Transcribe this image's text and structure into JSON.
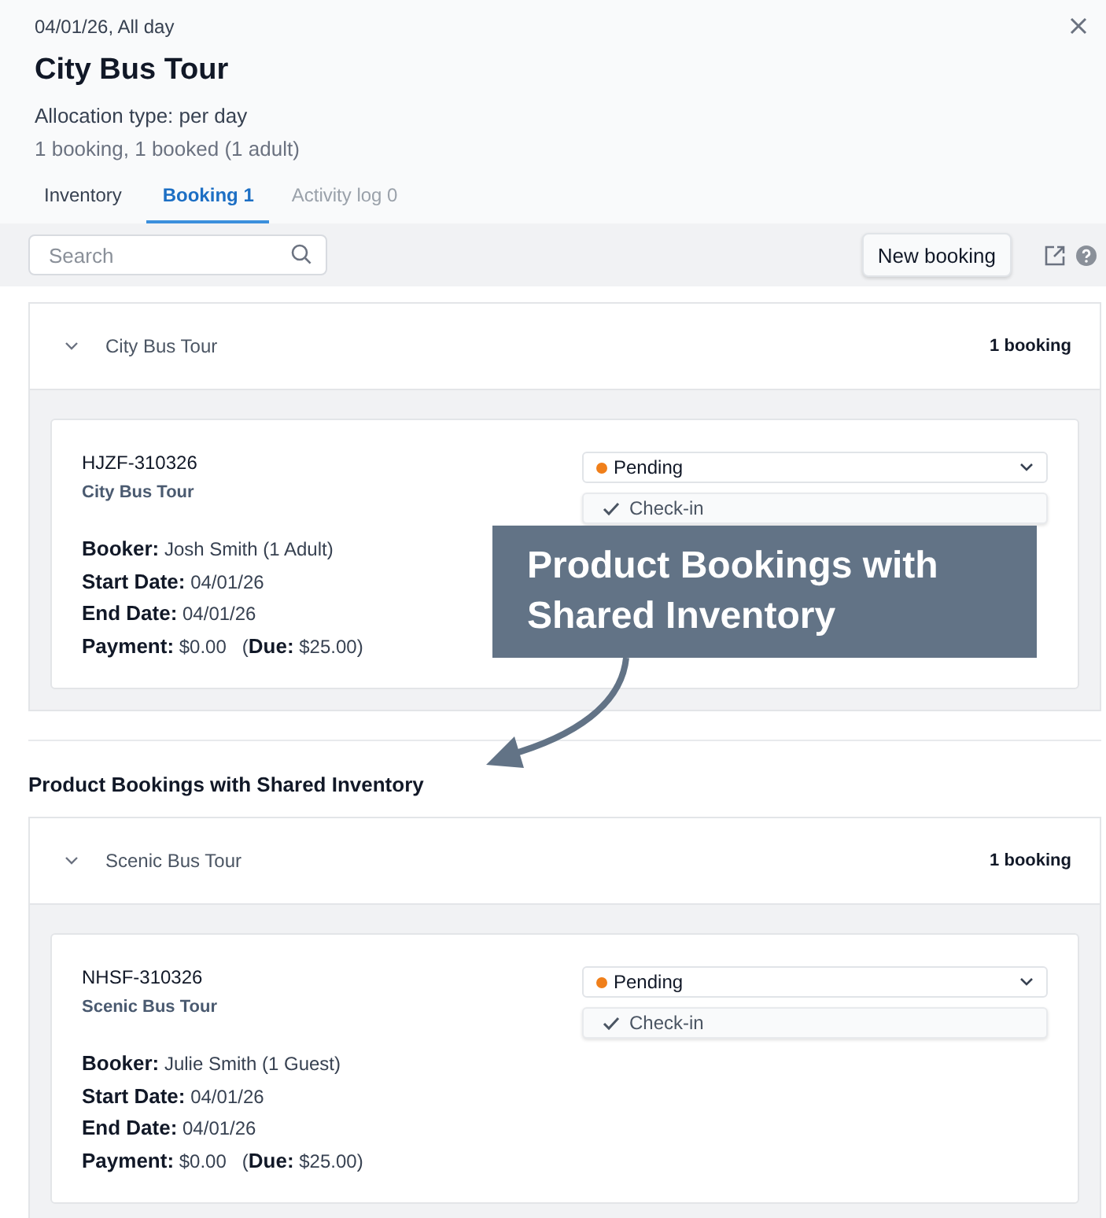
{
  "header": {
    "date": "04/01/26, All day",
    "title": "City Bus Tour",
    "allocation": "Allocation type: per day",
    "summary": "1 booking, 1 booked (1 adult)"
  },
  "tabs": [
    {
      "label": "Inventory",
      "selected": false,
      "disabled": false
    },
    {
      "label": "Booking 1",
      "selected": true,
      "disabled": false
    },
    {
      "label": "Activity log 0",
      "selected": false,
      "disabled": true
    }
  ],
  "toolbar": {
    "search": {
      "placeholder": "Search"
    },
    "new_booking": "New booking"
  },
  "groups": [
    {
      "product": "City Bus Tour",
      "count": "1 booking",
      "bookings": [
        {
          "code": "HJZF-310326",
          "product": "City Bus Tour",
          "status": "Pending",
          "color": "#f07f1a",
          "action": "Check-in",
          "lines": [
            "**Booker:** Josh Smith (1 Adult)",
            "**Start Date:** 04/01/26",
            "**End Date:** 04/01/26",
            "**Payment:** $0.00   (**Due:** $25.00)"
          ]
        }
      ]
    },
    {
      "heading": "Product Bookings with Shared Inventory",
      "product": "Scenic Bus Tour",
      "count": "1 booking",
      "bookings": [
        {
          "code": "NHSF-310326",
          "product": "Scenic Bus Tour",
          "status": "Pending",
          "color": "#f07f1a",
          "action": "Check-in",
          "lines": [
            "**Booker:** Julie Smith (1 Guest)",
            "**Start Date:** 04/01/26",
            "**End Date:** 04/01/26",
            "**Payment:** $0.00   (**Due:** $25.00)"
          ]
        }
      ]
    }
  ],
  "callout": {
    "text": "Product Bookings with Shared Inventory"
  }
}
